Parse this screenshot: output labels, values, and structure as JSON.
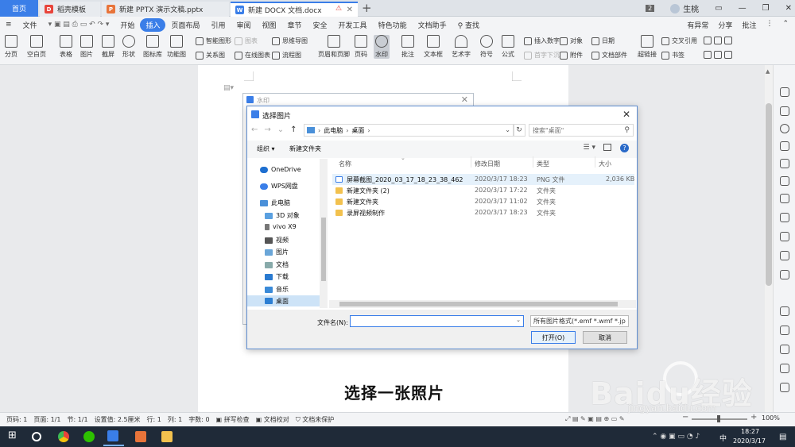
{
  "titlebar": {
    "tabs": [
      {
        "label": "首页"
      },
      {
        "label": "稻壳模板"
      },
      {
        "label": "新建 PPTX 演示文稿.pptx"
      },
      {
        "label": "新建 DOCX 文档.docx"
      }
    ],
    "new_tab": "+",
    "user": "生桃",
    "badge": "2"
  },
  "menubar": {
    "file": "文件",
    "items": [
      "开始",
      "插入",
      "页面布局",
      "引用",
      "审阅",
      "视图",
      "章节",
      "安全",
      "开发工具",
      "特色功能",
      "文档助手"
    ],
    "active": "插入",
    "search": "查找",
    "right": [
      "有异常",
      "分享",
      "批注"
    ]
  },
  "ribbon": {
    "buttons": [
      "分页",
      "空白页",
      "表格",
      "图片",
      "截屏",
      "形状",
      "图标库",
      "功能图",
      "页眉和页脚",
      "页码",
      "水印",
      "批注",
      "文本框",
      "艺术字",
      "符号",
      "公式",
      "超链接",
      "书签"
    ],
    "small": [
      "智能图形",
      "图表",
      "思维导图",
      "关系图",
      "在线图表",
      "流程图",
      "插入数字",
      "对象",
      "日期",
      "首字下沉",
      "附件",
      "文档部件",
      "交叉引用"
    ]
  },
  "watermark_dialog": {
    "title": "水印"
  },
  "file_dialog": {
    "title": "选择图片",
    "address": [
      "此电脑",
      "桌面"
    ],
    "search_placeholder": "搜索\"桌面\"",
    "organize": "组织",
    "new_folder": "新建文件夹",
    "nav": [
      "OneDrive",
      "WPS网盘",
      "此电脑",
      "3D 对象",
      "vivo X9",
      "视频",
      "图片",
      "文档",
      "下载",
      "音乐",
      "桌面"
    ],
    "columns": [
      "名称",
      "修改日期",
      "类型",
      "大小"
    ],
    "rows": [
      {
        "name": "屏幕截图_2020_03_17_18_23_38_462",
        "date": "2020/3/17 18:23",
        "type": "PNG 文件",
        "size": "2,036 KB"
      },
      {
        "name": "新建文件夹 (2)",
        "date": "2020/3/17 17:22",
        "type": "文件夹",
        "size": ""
      },
      {
        "name": "新建文件夹",
        "date": "2020/3/17 11:02",
        "type": "文件夹",
        "size": ""
      },
      {
        "name": "录屏视频制作",
        "date": "2020/3/17 18:23",
        "type": "文件夹",
        "size": ""
      }
    ],
    "filename_label": "文件名(N):",
    "filename_value": "",
    "filetype": "所有图片格式(*.emf *.wmf *.jp",
    "open": "打开(O)",
    "cancel": "取消"
  },
  "caption": "选择一张照片",
  "statusbar": {
    "items": [
      "页码: 1",
      "页面: 1/1",
      "节: 1/1",
      "设置值: 2.5厘米",
      "行: 1",
      "列: 1",
      "字数: 0",
      "拼写检查",
      "文档校对",
      "文档未保护"
    ],
    "zoom_minus": "−",
    "zoom_plus": "+",
    "zoom": "100%"
  },
  "taskbar": {
    "ime": "中",
    "time": "18:27",
    "date": "2020/3/17"
  },
  "baidu": {
    "logo": "Baidu经验",
    "url": "jingyan.baidu.com"
  },
  "colors": {
    "accent": "#3a7ee8",
    "selection": "#cde3f7",
    "taskbar": "#1f2a38"
  }
}
